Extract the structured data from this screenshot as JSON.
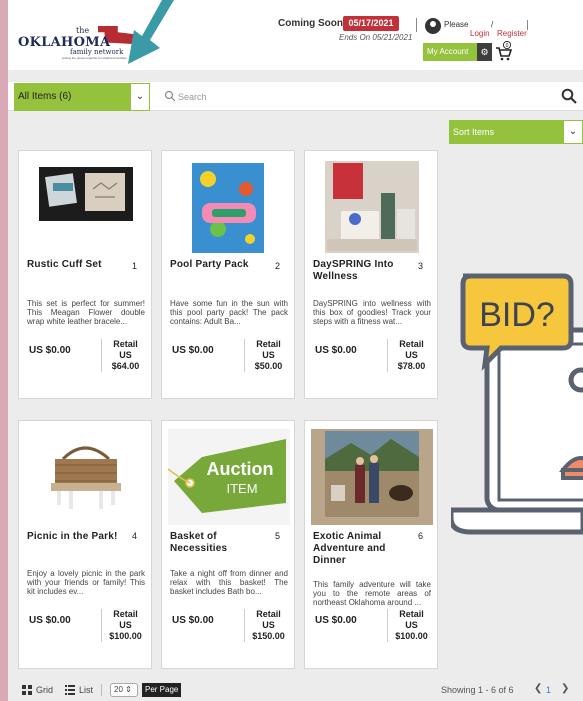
{
  "header": {
    "logo": {
      "the": "the",
      "name": "OKLAHOMA",
      "sub": "family network",
      "tagline": "putting the pieces together for oklahoma families"
    },
    "coming_soon": "Coming Soon",
    "date": "05/17/2021",
    "ends": "Ends On 05/21/2021",
    "please": "Please",
    "login": "Login",
    "slash": "/",
    "register": "Register",
    "my_account": "My Account",
    "cart_count": "0"
  },
  "filter": {
    "all_items": "All Items  (6)",
    "search_placeholder": "Search"
  },
  "sort": {
    "label": "Sort Items"
  },
  "items": [
    {
      "title": "Rustic Cuff Set",
      "num": "1",
      "desc": "This set is perfect for summer! This Meagan Flower double wrap white leather bracele...",
      "price": "US $0.00",
      "retail_label": "Retail",
      "retail_cur": "US",
      "retail": "$64.00"
    },
    {
      "title": "Pool Party Pack",
      "num": "2",
      "desc": "Have some fun in the sun with this pool party pack! The pack contains: Adult Ba...",
      "price": "US $0.00",
      "retail_label": "Retail",
      "retail_cur": "US",
      "retail": "$50.00"
    },
    {
      "title": "DaySPRING Into Wellness",
      "num": "3",
      "desc": "DaySPRING into wellness with this box of goodies! Track your steps with a fitness wat...",
      "price": "US $0.00",
      "retail_label": "Retail",
      "retail_cur": "US",
      "retail": "$78.00"
    },
    {
      "title": "Picnic in the Park!",
      "num": "4",
      "desc": "Enjoy a lovely picnic in the park with your friends or family! This kit includes ev...",
      "price": "US $0.00",
      "retail_label": "Retail",
      "retail_cur": "US",
      "retail": "$100.00"
    },
    {
      "title": "Basket of Necessities",
      "num": "5",
      "desc": "Take a night off from dinner and relax with this basket! The basket includes Bath bo...",
      "price": "US $0.00",
      "retail_label": "Retail",
      "retail_cur": "US",
      "retail": "$150.00"
    },
    {
      "title": "Exotic Animal Adventure and Dinner",
      "num": "6",
      "desc": "This family adventure will take you to the remote areas of northeast Oklahoma around ...",
      "price": "US $0.00",
      "retail_label": "Retail",
      "retail_cur": "US",
      "retail": "$100.00"
    }
  ],
  "auction_tag": {
    "line1": "Auction",
    "line2": "ITEM"
  },
  "promo": {
    "bid": "BID?"
  },
  "footer": {
    "grid": "Grid",
    "list": "List",
    "per_page_value": "20",
    "per_page": "Per Page",
    "showing": "Showing 1 - 6 of 6",
    "page": "1"
  },
  "colors": {
    "accent_green": "#95c23d",
    "brand_red": "#c2313a",
    "page_border": "#d9aab6",
    "arrow_teal": "#3a9aa6"
  }
}
